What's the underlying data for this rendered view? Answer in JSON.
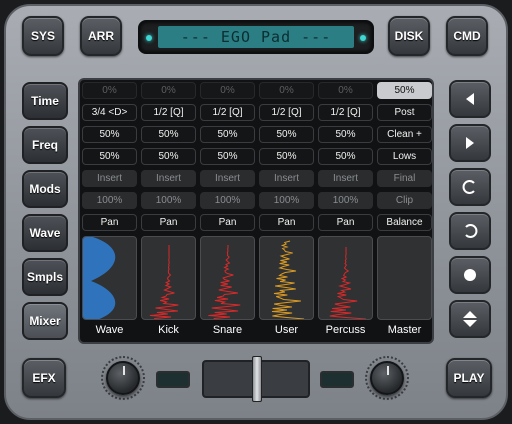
{
  "top_bar": {
    "sys": "SYS",
    "arr": "ARR",
    "disk": "DISK",
    "cmd": "CMD"
  },
  "display": {
    "text": "--- EGO Pad ---"
  },
  "left_tabs": [
    "Time",
    "Freq",
    "Mods",
    "Wave",
    "Smpls",
    "Mixer"
  ],
  "active_tab": "Mixer",
  "right_buttons": [
    "arrow-left-icon",
    "arrow-right-icon",
    "rotate-ccw-icon",
    "rotate-cw-icon",
    "record-dot-icon",
    "up-down-icon"
  ],
  "mixer": {
    "channels": [
      {
        "name": "Wave",
        "rows": [
          "0%",
          "3/4 <D>",
          "50%",
          "50%",
          "Insert",
          "100%",
          "Pan"
        ],
        "wave_color": "#2f7fd6"
      },
      {
        "name": "Kick",
        "rows": [
          "0%",
          "1/2 [Q]",
          "50%",
          "50%",
          "Insert",
          "100%",
          "Pan"
        ],
        "wave_color": "#d62a2a"
      },
      {
        "name": "Snare",
        "rows": [
          "0%",
          "1/2 [Q]",
          "50%",
          "50%",
          "Insert",
          "100%",
          "Pan"
        ],
        "wave_color": "#d62a2a"
      },
      {
        "name": "User",
        "rows": [
          "0%",
          "1/2 [Q]",
          "50%",
          "50%",
          "Insert",
          "100%",
          "Pan"
        ],
        "wave_color": "#d99a24"
      },
      {
        "name": "Percuss",
        "rows": [
          "0%",
          "1/2 [Q]",
          "50%",
          "50%",
          "Insert",
          "100%",
          "Pan"
        ],
        "wave_color": "#d62a2a"
      },
      {
        "name": "Master",
        "rows": [
          "50%",
          "Post",
          "Clean +",
          "Lows",
          "Final",
          "Clip",
          "Balance"
        ],
        "wave_color": ""
      }
    ]
  },
  "bottom": {
    "efx": "EFX",
    "play": "PLAY"
  }
}
